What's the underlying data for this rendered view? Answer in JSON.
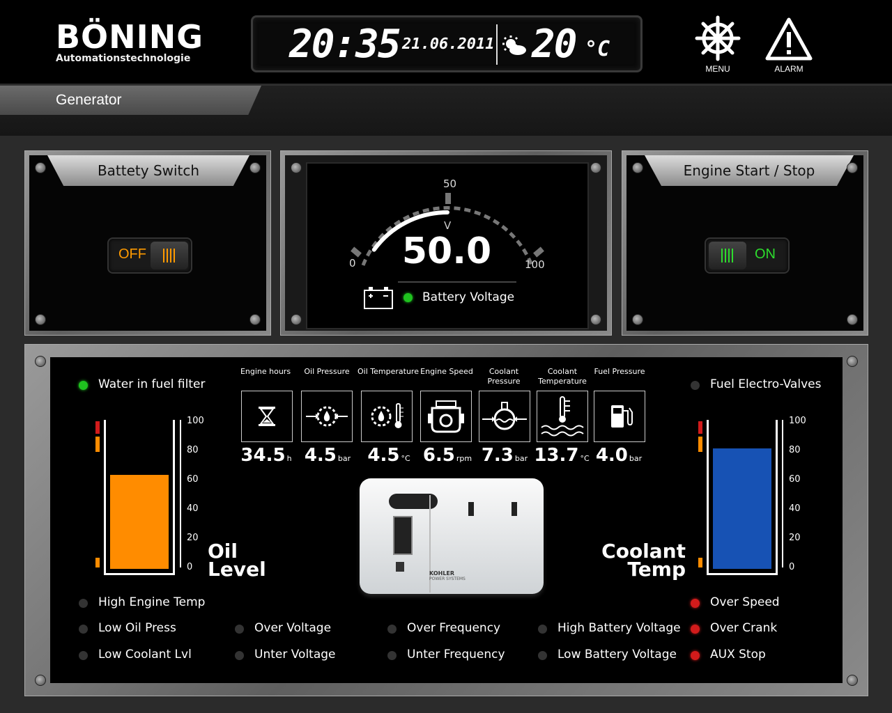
{
  "header": {
    "brand": "BÖNING",
    "brand_sub": "Automationstechnologie",
    "time": "20:35",
    "date": "21.06.2011",
    "temperature": "20",
    "temperature_unit": "°C",
    "menu_label": "MENU",
    "alarm_label": "ALARM"
  },
  "page": {
    "title": "Generator"
  },
  "battery_switch": {
    "title": "Battety Switch",
    "state_label": "OFF",
    "accent": "#ff9a00"
  },
  "voltage_gauge": {
    "value": "50.0",
    "value_num": 50,
    "unit": "V",
    "min_label": "0",
    "mid_label": "50",
    "max_label": "100",
    "max": 100,
    "label": "Battery Voltage"
  },
  "engine_switch": {
    "title": "Engine Start / Stop",
    "state_label": "ON",
    "accent": "#2ddc2d"
  },
  "indicators": {
    "water_in_fuel": "Water in fuel filter",
    "fuel_valves": "Fuel Electro-Valves"
  },
  "sensors": [
    {
      "caption": "Engine hours",
      "value": "34.5",
      "unit": "h",
      "icon": "hourglass-icon"
    },
    {
      "caption": "Oil Pressure",
      "value": "4.5",
      "unit": "bar",
      "icon": "oil-pressure-icon"
    },
    {
      "caption": "Oil Temperature",
      "value": "4.5",
      "unit": "°C",
      "icon": "oil-temperature-icon"
    },
    {
      "caption": "Engine Speed",
      "value": "6.5",
      "unit": "rpm",
      "icon": "engine-icon"
    },
    {
      "caption": "Coolant Pressure",
      "value": "7.3",
      "unit": "bar",
      "icon": "coolant-pressure-icon"
    },
    {
      "caption": "Coolant Temperature",
      "value": "13.7",
      "unit": "°C",
      "icon": "coolant-temperature-icon"
    },
    {
      "caption": "Fuel Pressure",
      "value": "4.0",
      "unit": "bar",
      "icon": "fuel-pump-icon"
    }
  ],
  "oil_tank": {
    "label_line1": "Oil",
    "label_line2": "Level",
    "level": 65,
    "color": "#ff8c00"
  },
  "coolant_tank": {
    "label_line1": "Coolant",
    "label_line2": "Temp",
    "level": 83,
    "color": "#1752b4"
  },
  "tank_scale": [
    "100",
    "80",
    "60",
    "40",
    "20",
    "0"
  ],
  "generator_brand": {
    "name": "KOHLER",
    "sub": "POWER SYSTEMS"
  },
  "alarms": {
    "high_engine_temp": "High Engine Temp",
    "low_oil_press": "Low Oil Press",
    "low_coolant_lvl": "Low Coolant Lvl",
    "over_voltage": "Over Voltage",
    "unter_voltage": "Unter Voltage",
    "over_frequency": "Over Frequency",
    "unter_frequency": "Unter Frequency",
    "high_battery_voltage": "High Battery Voltage",
    "low_battery_voltage": "Low Battery Voltage",
    "over_speed": "Over Speed",
    "over_crank": "Over Crank",
    "aux_stop": "AUX Stop"
  }
}
